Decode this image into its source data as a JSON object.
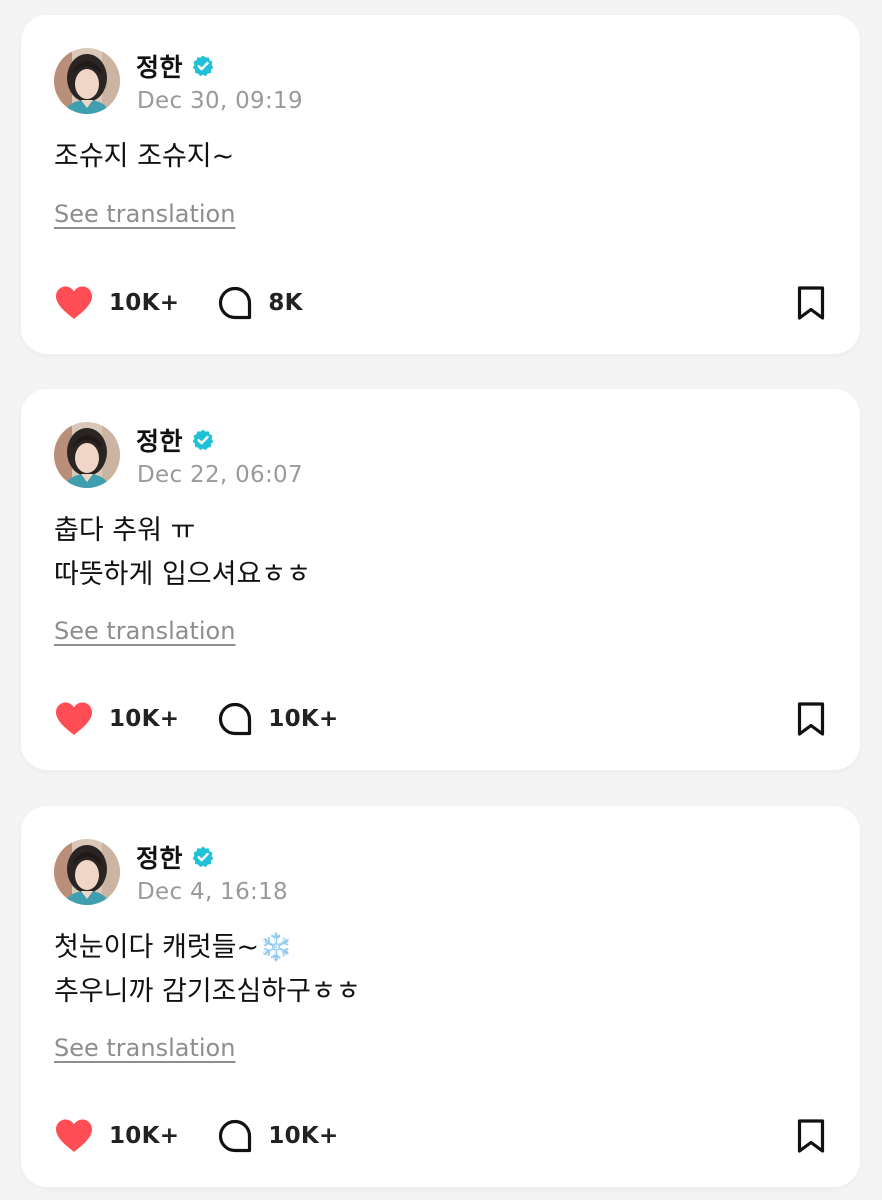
{
  "colors": {
    "background": "#f4f4f4",
    "card": "#ffffff",
    "like": "#ff4d55",
    "verified": "#1fc1d6",
    "muted": "#9a9a9a"
  },
  "posts": [
    {
      "author": "정한",
      "verified_icon": "verified-badge-icon",
      "date": "Dec 30, 09:19",
      "body": [
        "조슈지 조슈지~"
      ],
      "translation_label": "See translation",
      "likes": "10K+",
      "comments": "8K"
    },
    {
      "author": "정한",
      "verified_icon": "verified-badge-icon",
      "date": "Dec 22, 06:07",
      "body": [
        "춥다 추워 ㅠ",
        "따뜻하게 입으셔요ㅎㅎ"
      ],
      "translation_label": "See translation",
      "likes": "10K+",
      "comments": "10K+"
    },
    {
      "author": "정한",
      "verified_icon": "verified-badge-icon",
      "date": "Dec 4, 16:18",
      "body": [
        "첫눈이다 캐럿들~❄️",
        "추우니까 감기조심하구ㅎㅎ"
      ],
      "translation_label": "See translation",
      "likes": "10K+",
      "comments": "10K+"
    }
  ]
}
